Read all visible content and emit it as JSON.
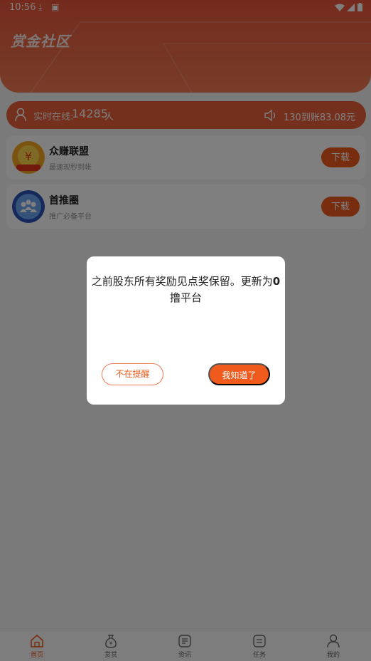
{
  "status_bar": {
    "time": "10:56"
  },
  "app": {
    "title": "赏金社区"
  },
  "online": {
    "label": "实时在线:",
    "count": "14285",
    "unit": "人",
    "marquee": "130到账83.08元"
  },
  "apps": [
    {
      "name": "众赚联盟",
      "desc": "最速现秒到帐",
      "download": "下载",
      "logo_text": "众赚联盟"
    },
    {
      "name": "首推圈",
      "desc": "推广必备平台",
      "download": "下载"
    }
  ],
  "dialog": {
    "message_main": "之前股东所有奖励见点奖保留。更新为",
    "message_bold": "0",
    "message_tail": "撸平台",
    "later_label": "不在提醒",
    "ok_label": "我知道了"
  },
  "tabs": [
    {
      "label": "首页",
      "icon": "home-icon",
      "active": true
    },
    {
      "label": "赏赏",
      "icon": "money-bag-icon"
    },
    {
      "label": "资讯",
      "icon": "news-icon"
    },
    {
      "label": "任务",
      "icon": "task-icon"
    },
    {
      "label": "我的",
      "icon": "user-icon"
    }
  ],
  "colors": {
    "accent": "#f05a1c",
    "header": "#e8563a"
  }
}
